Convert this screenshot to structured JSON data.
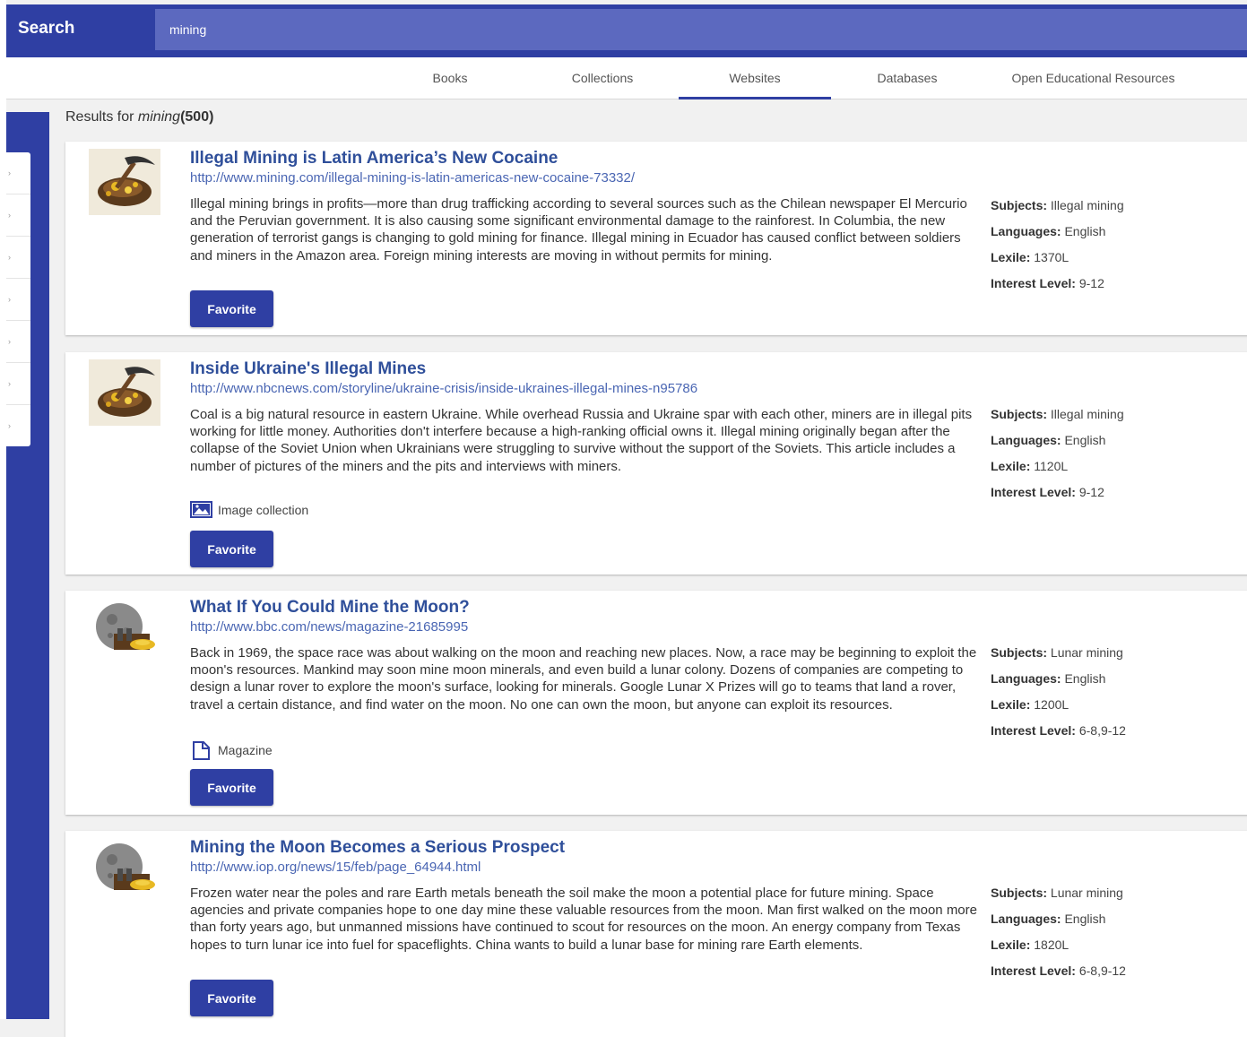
{
  "header": {
    "search_label": "Search",
    "search_value": "mining"
  },
  "tabs": [
    {
      "label": "Books"
    },
    {
      "label": "Collections"
    },
    {
      "label": "Websites",
      "active": true
    },
    {
      "label": "Databases"
    },
    {
      "label": "Open Educational Resources"
    }
  ],
  "results": {
    "prefix": "Results for",
    "query": "mining",
    "count": "(500)"
  },
  "labels": {
    "subjects": "Subjects:",
    "languages": "Languages:",
    "lexile": "Lexile:",
    "interest": "Interest Level:"
  },
  "items": [
    {
      "title": "Illegal Mining is Latin America’s New Cocaine",
      "url": "http://www.mining.com/illegal-mining-is-latin-americas-new-cocaine-73332/",
      "description": "Illegal mining brings in profits—more than drug trafficking according to several sources such as the Chilean newspaper El Mercurio and the Peruvian government. It is also causing some significant environmental damage to the rainforest. In Columbia, the new generation of terrorist gangs is changing to gold mining for finance. Illegal mining in Ecuador has caused conflict between soldiers and miners in the Amazon area. Foreign mining interests are moving in without permits for mining.",
      "resource_type": "",
      "favorite_label": "Favorite",
      "subjects": "Illegal mining",
      "languages": "English",
      "lexile": "1370L",
      "interest": "9-12",
      "thumb_icon": "pickaxe-gold-icon"
    },
    {
      "title": "Inside Ukraine's Illegal Mines",
      "url": "http://www.nbcnews.com/storyline/ukraine-crisis/inside-ukraines-illegal-mines-n95786",
      "description": "Coal is a big natural resource in eastern Ukraine. While overhead Russia and Ukraine spar with each other, miners are in illegal pits working for little money. Authorities don't interfere because a high-ranking official owns it. Illegal mining originally began after the collapse of the Soviet Union when Ukrainians were struggling to survive without the support of the Soviets. This article includes a number of pictures of the miners and the pits and interviews with miners.",
      "resource_type": "Image collection",
      "resource_icon": "image-collection-icon",
      "favorite_label": "Favorite",
      "subjects": "Illegal mining",
      "languages": "English",
      "lexile": "1120L",
      "interest": "9-12",
      "thumb_icon": "pickaxe-gold-icon"
    },
    {
      "title": "What If You Could Mine the Moon?",
      "url": "http://www.bbc.com/news/magazine-21685995",
      "description": "Back in 1969, the space race was about walking on the moon and reaching new places. Now, a race may be beginning to exploit the moon's resources. Mankind may soon mine moon minerals, and even build a lunar colony. Dozens of companies are competing to design a lunar rover to explore the moon's surface, looking for minerals. Google Lunar X Prizes will go to teams that land a rover, travel a certain distance, and find water on the moon. No one can own the moon, but anyone can exploit its resources.",
      "resource_type": "Magazine",
      "resource_icon": "magazine-icon",
      "favorite_label": "Favorite",
      "subjects": "Lunar mining",
      "languages": "English",
      "lexile": "1200L",
      "interest": "6-8,9-12",
      "thumb_icon": "moon-mining-icon"
    },
    {
      "title": "Mining the Moon Becomes a Serious Prospect",
      "url": "http://www.iop.org/news/15/feb/page_64944.html",
      "description": "Frozen water near the poles and rare Earth metals beneath the soil make the moon a potential place for future mining. Space agencies and private companies hope to one day mine these valuable resources from the moon. Man first walked on the moon more than forty years ago, but unmanned missions have continued to scout for resources on the moon. An energy company from Texas hopes to turn lunar ice into fuel for spaceflights. China wants to build a lunar base for mining rare Earth elements.",
      "resource_type": "",
      "favorite_label": "Favorite",
      "subjects": "Lunar mining",
      "languages": "English",
      "lexile": "1820L",
      "interest": "6-8,9-12",
      "thumb_icon": "moon-mining-icon"
    }
  ]
}
